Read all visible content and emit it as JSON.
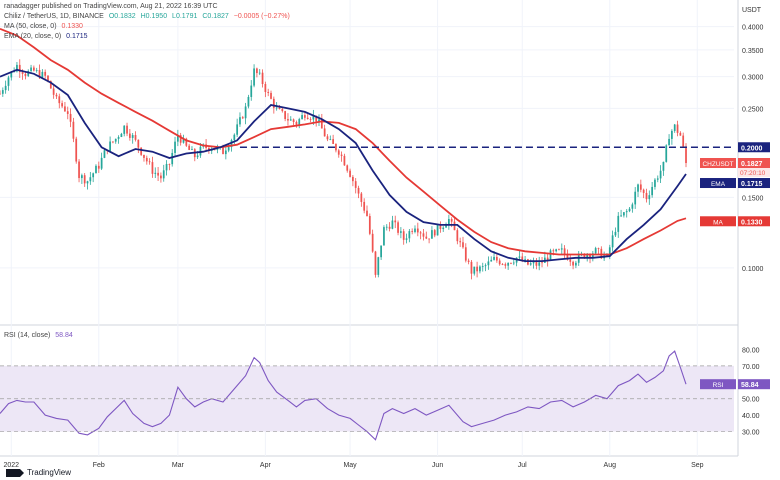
{
  "header": {
    "published": "ranadagger published on TradingView.com, Aug 21, 2022 16:39 UTC",
    "symbol": "Chiliz / TetherUS, 1D, BINANCE",
    "ohlc": [
      "O0.1832",
      "H0.1950",
      "L0.1791",
      "C0.1827",
      "−0.0005 (−0.27%)"
    ],
    "ma_label": "MA (50, close, 0)",
    "ma_value": "0.1330",
    "ema_label": "EMA (20, close, 0)",
    "ema_value": "0.1715"
  },
  "rsi_legend": {
    "label": "RSI (14, close)",
    "value": "58.84"
  },
  "logo_text": "TradingView",
  "colors": {
    "up": "#26a69a",
    "down": "#ef5350",
    "ema": "#1a237e",
    "ma": "#e53935",
    "resistance": "#1a237e",
    "rsi": "#7e57c2",
    "rsi_band": "#ede7f6"
  },
  "chart_data": {
    "type": "candlestick",
    "currency": "USDT",
    "y_ticks": [
      "0.4000",
      "0.3500",
      "0.3000",
      "0.2500",
      "0.1500",
      "0.1000"
    ],
    "ylim": [
      0.075,
      0.43
    ],
    "x_ticks": [
      "2022",
      "Feb",
      "Mar",
      "Apr",
      "May",
      "Jun",
      "Jul",
      "Aug",
      "Sep"
    ],
    "x_tick_days": [
      0,
      31,
      59,
      90,
      120,
      151,
      181,
      212,
      243
    ],
    "x_range_days": [
      -4,
      256
    ],
    "close_anchors": [
      [
        -4,
        0.272
      ],
      [
        -1,
        0.3
      ],
      [
        2,
        0.32
      ],
      [
        5,
        0.306
      ],
      [
        8,
        0.31
      ],
      [
        12,
        0.3
      ],
      [
        16,
        0.262
      ],
      [
        20,
        0.245
      ],
      [
        24,
        0.17
      ],
      [
        27,
        0.165
      ],
      [
        31,
        0.18
      ],
      [
        34,
        0.2
      ],
      [
        37,
        0.21
      ],
      [
        40,
        0.225
      ],
      [
        43,
        0.212
      ],
      [
        47,
        0.19
      ],
      [
        50,
        0.175
      ],
      [
        53,
        0.168
      ],
      [
        56,
        0.182
      ],
      [
        59,
        0.215
      ],
      [
        62,
        0.2
      ],
      [
        65,
        0.19
      ],
      [
        68,
        0.2
      ],
      [
        71,
        0.2
      ],
      [
        75,
        0.195
      ],
      [
        79,
        0.215
      ],
      [
        83,
        0.25
      ],
      [
        86,
        0.31
      ],
      [
        88,
        0.3
      ],
      [
        91,
        0.27
      ],
      [
        94,
        0.248
      ],
      [
        98,
        0.235
      ],
      [
        101,
        0.23
      ],
      [
        104,
        0.243
      ],
      [
        108,
        0.236
      ],
      [
        112,
        0.208
      ],
      [
        116,
        0.196
      ],
      [
        120,
        0.172
      ],
      [
        123,
        0.152
      ],
      [
        126,
        0.135
      ],
      [
        129,
        0.095
      ],
      [
        132,
        0.125
      ],
      [
        135,
        0.13
      ],
      [
        139,
        0.118
      ],
      [
        143,
        0.128
      ],
      [
        147,
        0.119
      ],
      [
        151,
        0.125
      ],
      [
        155,
        0.132
      ],
      [
        160,
        0.11
      ],
      [
        163,
        0.098
      ],
      [
        167,
        0.1
      ],
      [
        171,
        0.105
      ],
      [
        175,
        0.103
      ],
      [
        179,
        0.106
      ],
      [
        183,
        0.102
      ],
      [
        187,
        0.102
      ],
      [
        191,
        0.108
      ],
      [
        195,
        0.11
      ],
      [
        199,
        0.104
      ],
      [
        203,
        0.108
      ],
      [
        207,
        0.11
      ],
      [
        211,
        0.106
      ],
      [
        215,
        0.132
      ],
      [
        219,
        0.14
      ],
      [
        222,
        0.16
      ],
      [
        225,
        0.15
      ],
      [
        228,
        0.165
      ],
      [
        231,
        0.18
      ],
      [
        233,
        0.215
      ],
      [
        235,
        0.225
      ],
      [
        237,
        0.214
      ],
      [
        239,
        0.1827
      ]
    ],
    "ema": {
      "name": "EMA",
      "value": 0.1715,
      "points": [
        [
          -4,
          0.3
        ],
        [
          2,
          0.312
        ],
        [
          8,
          0.305
        ],
        [
          14,
          0.29
        ],
        [
          20,
          0.27
        ],
        [
          26,
          0.23
        ],
        [
          32,
          0.2
        ],
        [
          38,
          0.19
        ],
        [
          44,
          0.198
        ],
        [
          50,
          0.195
        ],
        [
          56,
          0.188
        ],
        [
          62,
          0.193
        ],
        [
          68,
          0.195
        ],
        [
          74,
          0.2
        ],
        [
          80,
          0.208
        ],
        [
          86,
          0.232
        ],
        [
          92,
          0.255
        ],
        [
          98,
          0.25
        ],
        [
          104,
          0.245
        ],
        [
          110,
          0.235
        ],
        [
          116,
          0.222
        ],
        [
          122,
          0.205
        ],
        [
          128,
          0.175
        ],
        [
          134,
          0.152
        ],
        [
          140,
          0.138
        ],
        [
          146,
          0.13
        ],
        [
          152,
          0.128
        ],
        [
          158,
          0.128
        ],
        [
          164,
          0.118
        ],
        [
          170,
          0.11
        ],
        [
          176,
          0.106
        ],
        [
          182,
          0.104
        ],
        [
          188,
          0.104
        ],
        [
          194,
          0.105
        ],
        [
          200,
          0.106
        ],
        [
          206,
          0.106
        ],
        [
          212,
          0.107
        ],
        [
          218,
          0.118
        ],
        [
          224,
          0.128
        ],
        [
          230,
          0.14
        ],
        [
          236,
          0.16
        ],
        [
          239,
          0.1715
        ]
      ]
    },
    "ma": {
      "name": "MA",
      "value": 0.133,
      "points": [
        [
          -4,
          0.395
        ],
        [
          2,
          0.38
        ],
        [
          8,
          0.355
        ],
        [
          14,
          0.33
        ],
        [
          20,
          0.312
        ],
        [
          26,
          0.29
        ],
        [
          32,
          0.272
        ],
        [
          38,
          0.258
        ],
        [
          44,
          0.245
        ],
        [
          50,
          0.233
        ],
        [
          56,
          0.22
        ],
        [
          62,
          0.208
        ],
        [
          68,
          0.202
        ],
        [
          74,
          0.2
        ],
        [
          80,
          0.203
        ],
        [
          86,
          0.212
        ],
        [
          92,
          0.222
        ],
        [
          98,
          0.225
        ],
        [
          104,
          0.228
        ],
        [
          110,
          0.232
        ],
        [
          116,
          0.23
        ],
        [
          122,
          0.222
        ],
        [
          128,
          0.205
        ],
        [
          134,
          0.185
        ],
        [
          140,
          0.168
        ],
        [
          146,
          0.155
        ],
        [
          152,
          0.143
        ],
        [
          158,
          0.132
        ],
        [
          164,
          0.123
        ],
        [
          170,
          0.116
        ],
        [
          176,
          0.112
        ],
        [
          182,
          0.11
        ],
        [
          188,
          0.109
        ],
        [
          194,
          0.108
        ],
        [
          200,
          0.108
        ],
        [
          206,
          0.108
        ],
        [
          212,
          0.108
        ],
        [
          218,
          0.112
        ],
        [
          224,
          0.118
        ],
        [
          230,
          0.124
        ],
        [
          236,
          0.131
        ],
        [
          239,
          0.133
        ]
      ]
    },
    "resistance": {
      "value": 0.2,
      "label": "0.2000",
      "from_day": 81
    },
    "last_price": {
      "value": 0.1827,
      "symbol": "CHZUSDT",
      "price_label": "0.1827",
      "countdown": "07:20:10"
    },
    "rsi": {
      "name": "RSI",
      "value": 58.84,
      "ylim": [
        20,
        90
      ],
      "y_ticks": [
        "80.00",
        "70.00",
        "60.00",
        "50.00",
        "40.00",
        "30.00"
      ],
      "y_tick_values": [
        80,
        70,
        60,
        50,
        40,
        30
      ],
      "band": [
        30,
        70
      ],
      "points": [
        [
          -4,
          41
        ],
        [
          -1,
          47
        ],
        [
          2,
          49
        ],
        [
          5,
          48
        ],
        [
          8,
          48
        ],
        [
          12,
          40
        ],
        [
          16,
          38
        ],
        [
          20,
          37
        ],
        [
          24,
          29
        ],
        [
          27,
          28
        ],
        [
          31,
          32
        ],
        [
          34,
          39
        ],
        [
          37,
          44
        ],
        [
          40,
          49
        ],
        [
          43,
          41
        ],
        [
          47,
          35
        ],
        [
          50,
          33
        ],
        [
          53,
          35
        ],
        [
          56,
          40
        ],
        [
          59,
          57
        ],
        [
          62,
          50
        ],
        [
          65,
          45
        ],
        [
          68,
          48
        ],
        [
          71,
          50
        ],
        [
          75,
          48
        ],
        [
          79,
          56
        ],
        [
          83,
          64
        ],
        [
          86,
          75
        ],
        [
          88,
          72
        ],
        [
          91,
          61
        ],
        [
          94,
          54
        ],
        [
          98,
          49
        ],
        [
          101,
          45
        ],
        [
          104,
          49
        ],
        [
          108,
          50
        ],
        [
          112,
          44
        ],
        [
          116,
          40
        ],
        [
          120,
          38
        ],
        [
          123,
          34
        ],
        [
          126,
          30
        ],
        [
          129,
          25
        ],
        [
          132,
          41
        ],
        [
          135,
          44
        ],
        [
          139,
          41
        ],
        [
          143,
          44
        ],
        [
          147,
          40
        ],
        [
          151,
          43
        ],
        [
          155,
          46
        ],
        [
          160,
          36
        ],
        [
          163,
          33
        ],
        [
          167,
          35
        ],
        [
          171,
          37
        ],
        [
          175,
          40
        ],
        [
          179,
          42
        ],
        [
          183,
          45
        ],
        [
          187,
          44
        ],
        [
          191,
          48
        ],
        [
          195,
          49
        ],
        [
          199,
          45
        ],
        [
          203,
          48
        ],
        [
          207,
          52
        ],
        [
          211,
          50
        ],
        [
          215,
          58
        ],
        [
          219,
          61
        ],
        [
          222,
          65
        ],
        [
          225,
          60
        ],
        [
          228,
          63
        ],
        [
          231,
          67
        ],
        [
          233,
          76
        ],
        [
          235,
          79
        ],
        [
          237,
          69
        ],
        [
          239,
          58.84
        ]
      ]
    }
  }
}
